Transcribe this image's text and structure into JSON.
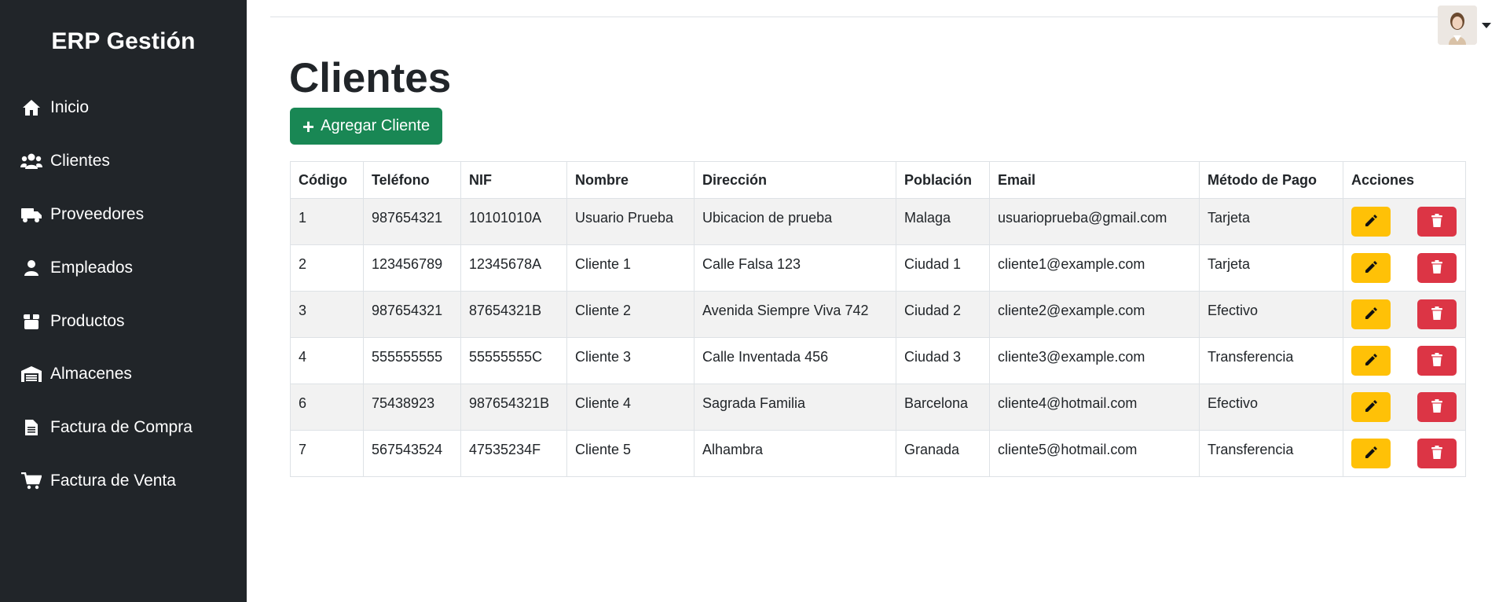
{
  "sidebar": {
    "brand": "ERP Gestión",
    "items": [
      {
        "label": "Inicio",
        "icon": "home-icon"
      },
      {
        "label": "Clientes",
        "icon": "users-icon"
      },
      {
        "label": "Proveedores",
        "icon": "truck-icon"
      },
      {
        "label": "Empleados",
        "icon": "user-icon"
      },
      {
        "label": "Productos",
        "icon": "box-icon"
      },
      {
        "label": "Almacenes",
        "icon": "warehouse-icon"
      },
      {
        "label": "Factura de Compra",
        "icon": "document-icon"
      },
      {
        "label": "Factura de Venta",
        "icon": "cart-icon"
      }
    ]
  },
  "main": {
    "title": "Clientes",
    "add_button": "Agregar Cliente",
    "table": {
      "headers": [
        "Código",
        "Teléfono",
        "NIF",
        "Nombre",
        "Dirección",
        "Población",
        "Email",
        "Método de Pago",
        "Acciones"
      ],
      "rows": [
        [
          "1",
          "987654321",
          "10101010A",
          "Usuario Prueba",
          "Ubicacion de prueba",
          "Malaga",
          "usuarioprueba@gmail.com",
          "Tarjeta"
        ],
        [
          "2",
          "123456789",
          "12345678A",
          "Cliente 1",
          "Calle Falsa 123",
          "Ciudad 1",
          "cliente1@example.com",
          "Tarjeta"
        ],
        [
          "3",
          "987654321",
          "87654321B",
          "Cliente 2",
          "Avenida Siempre Viva 742",
          "Ciudad 2",
          "cliente2@example.com",
          "Efectivo"
        ],
        [
          "4",
          "555555555",
          "55555555C",
          "Cliente 3",
          "Calle Inventada 456",
          "Ciudad 3",
          "cliente3@example.com",
          "Transferencia"
        ],
        [
          "6",
          "75438923",
          "987654321B",
          "Cliente 4",
          "Sagrada Familia",
          "Barcelona",
          "cliente4@hotmail.com",
          "Efectivo"
        ],
        [
          "7",
          "567543524",
          "47535234F",
          "Cliente 5",
          "Alhambra",
          "Granada",
          "cliente5@hotmail.com",
          "Transferencia"
        ]
      ]
    }
  },
  "colors": {
    "sidebar_bg": "#212529",
    "add_button": "#198754",
    "edit_button": "#ffc107",
    "delete_button": "#dc3545",
    "striped_row": "#f2f2f2"
  }
}
